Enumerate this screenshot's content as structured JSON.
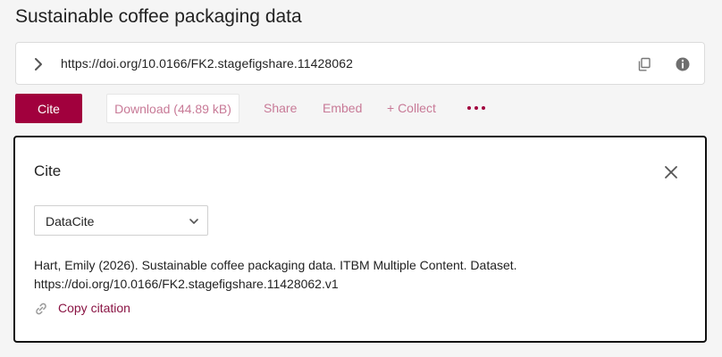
{
  "page": {
    "title": "Sustainable coffee packaging data"
  },
  "doi_bar": {
    "doi": "https://doi.org/10.0166/FK2.stagefigshare.11428062",
    "icons": {
      "expand": "chevron-right-icon",
      "copy": "copy-icon",
      "info": "info-icon"
    }
  },
  "actions": {
    "cite_label": "Cite",
    "download_label": "Download (44.89 kB)",
    "share_label": "Share",
    "embed_label": "Embed",
    "collect_label": "+ Collect",
    "more_icon": "more-horizontal-icon"
  },
  "cite_panel": {
    "title": "Cite",
    "style_selected": "DataCite",
    "citation_line1": "Hart, Emily (2026). Sustainable coffee packaging data. ITBM Multiple Content. Dataset.",
    "citation_line2": "https://doi.org/10.0166/FK2.stagefigshare.11428062.v1",
    "copy_label": "Copy citation"
  },
  "colors": {
    "accent": "#a1003d",
    "accent_light": "#c87a97",
    "link": "#8a1444",
    "background": "#f5f5f5"
  }
}
